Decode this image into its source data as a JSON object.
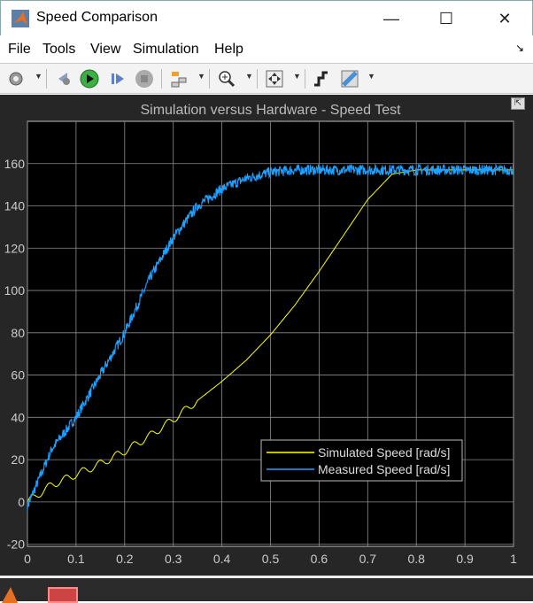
{
  "window": {
    "title": "Speed Comparison",
    "minimize": "—",
    "maximize": "☐",
    "close": "✕"
  },
  "menu": [
    "File",
    "Tools",
    "View",
    "Simulation",
    "Help"
  ],
  "toolbar": [
    {
      "icon": "gear-icon"
    },
    {
      "icon": "step-back-icon"
    },
    {
      "icon": "run-icon"
    },
    {
      "icon": "step-forward-icon"
    },
    {
      "icon": "stop-icon"
    },
    {
      "icon": "signal-selector-icon"
    },
    {
      "icon": "zoom-in-icon"
    },
    {
      "icon": "fit-view-icon"
    },
    {
      "icon": "triggers-icon"
    },
    {
      "icon": "measurements-icon"
    }
  ],
  "colors": {
    "background": "#000000",
    "axes": "#262626",
    "grid": "#8c8c8c",
    "simulated": "#ffff00",
    "measured": "#1fa1ff"
  },
  "chart_data": {
    "type": "line",
    "title": "Simulation versus Hardware - Speed Test",
    "xlim": [
      0,
      1
    ],
    "ylim": [
      -21,
      180
    ],
    "xticks": [
      "0",
      "0.1",
      "0.2",
      "0.3",
      "0.4",
      "0.5",
      "0.6",
      "0.7",
      "0.8",
      "0.9",
      "1"
    ],
    "yticks": [
      "-20",
      "0",
      "20",
      "40",
      "60",
      "80",
      "100",
      "120",
      "140",
      "160"
    ],
    "grid": true,
    "legend_placement": "bottom-right",
    "x": [
      0,
      0.05,
      0.1,
      0.15,
      0.2,
      0.25,
      0.3,
      0.35,
      0.4,
      0.45,
      0.5,
      0.55,
      0.6,
      0.65,
      0.7,
      0.75,
      0.8,
      0.85,
      0.9,
      0.95,
      1
    ],
    "series": [
      {
        "name": "Simulated Speed [rad/s]",
        "values": [
          0,
          8,
          13,
          18,
          24,
          31,
          39,
          48,
          57,
          67,
          79,
          93,
          109,
          126,
          143,
          155,
          157,
          157,
          157,
          157,
          157
        ]
      },
      {
        "name": "Measured Speed [rad/s]",
        "values": [
          -2,
          25,
          40,
          60,
          80,
          105,
          125,
          140,
          148,
          153,
          156,
          157,
          157,
          157,
          157,
          157,
          157,
          157,
          157,
          157,
          157
        ]
      }
    ]
  }
}
